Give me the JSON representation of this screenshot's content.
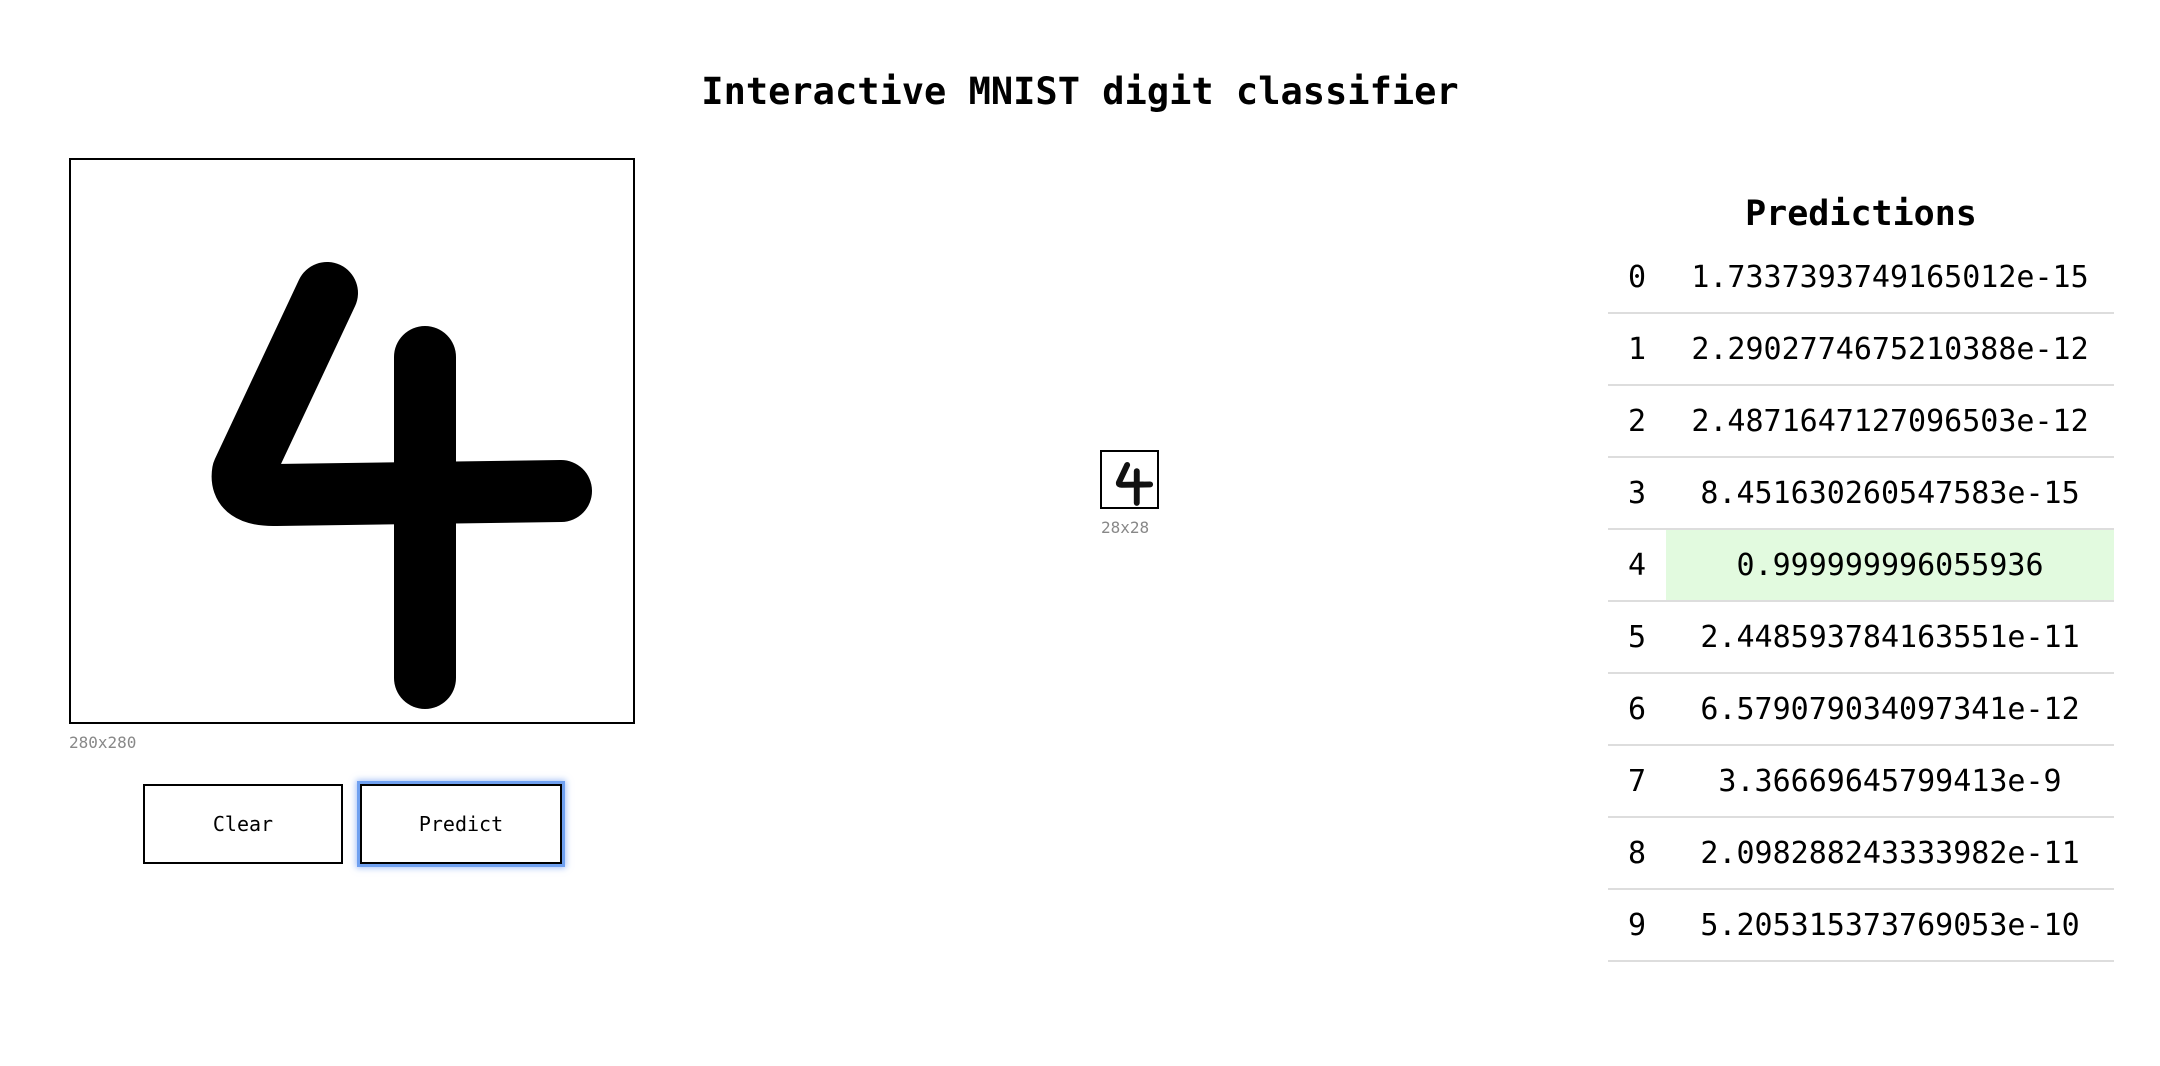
{
  "page": {
    "title": "Interactive MNIST digit classifier"
  },
  "canvas": {
    "size_label": "280x280",
    "drawn_digit": "4"
  },
  "buttons": {
    "clear_label": "Clear",
    "predict_label": "Predict"
  },
  "preview": {
    "size_label": "28x28"
  },
  "predictions": {
    "title": "Predictions",
    "highlight_color": "#e2fadf",
    "predicted_digit": 4,
    "rows": [
      {
        "digit": "0",
        "value": "1.7337393749165012e-15"
      },
      {
        "digit": "1",
        "value": "2.2902774675210388e-12"
      },
      {
        "digit": "2",
        "value": "2.4871647127096503e-12"
      },
      {
        "digit": "3",
        "value": "8.451630260547583e-15"
      },
      {
        "digit": "4",
        "value": "0.999999996055936"
      },
      {
        "digit": "5",
        "value": "2.448593784163551e-11"
      },
      {
        "digit": "6",
        "value": "6.579079034097341e-12"
      },
      {
        "digit": "7",
        "value": "3.36669645799413e-9"
      },
      {
        "digit": "8",
        "value": "2.098288243333982e-11"
      },
      {
        "digit": "9",
        "value": "5.205315373769053e-10"
      }
    ]
  }
}
